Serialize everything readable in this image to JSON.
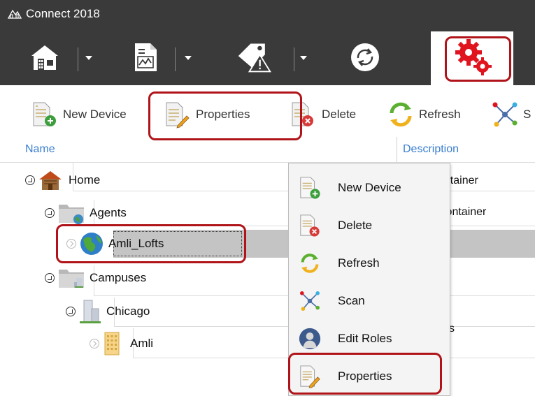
{
  "window": {
    "title": "Connect 2018"
  },
  "toolbar": {
    "home_icon": "home-icon",
    "reports_icon": "chart-document-icon",
    "alarms_icon": "tag-warning-icon",
    "sync_icon": "sync-icon",
    "settings_icon": "gears-icon"
  },
  "actions": {
    "new_device": "New Device",
    "properties": "Properties",
    "delete": "Delete",
    "refresh": "Refresh",
    "scan_partial": "S"
  },
  "columns": {
    "name": "Name",
    "description": "Description"
  },
  "tree": {
    "home": "Home",
    "agents": "Agents",
    "amli_lofts": "Amli_Lofts",
    "campuses": "Campuses",
    "chicago": "Chicago",
    "amli": "Amli"
  },
  "descriptions": {
    "home": "ontainer",
    "agents": "Container",
    "chicago": "s"
  },
  "context_menu": {
    "new_device": "New Device",
    "delete": "Delete",
    "refresh": "Refresh",
    "scan": "Scan",
    "edit_roles": "Edit Roles",
    "properties": "Properties"
  },
  "colors": {
    "accent": "#3a7fcf",
    "highlight": "#b0141a",
    "settings_red": "#e0141e",
    "dark": "#3a3a3a"
  }
}
